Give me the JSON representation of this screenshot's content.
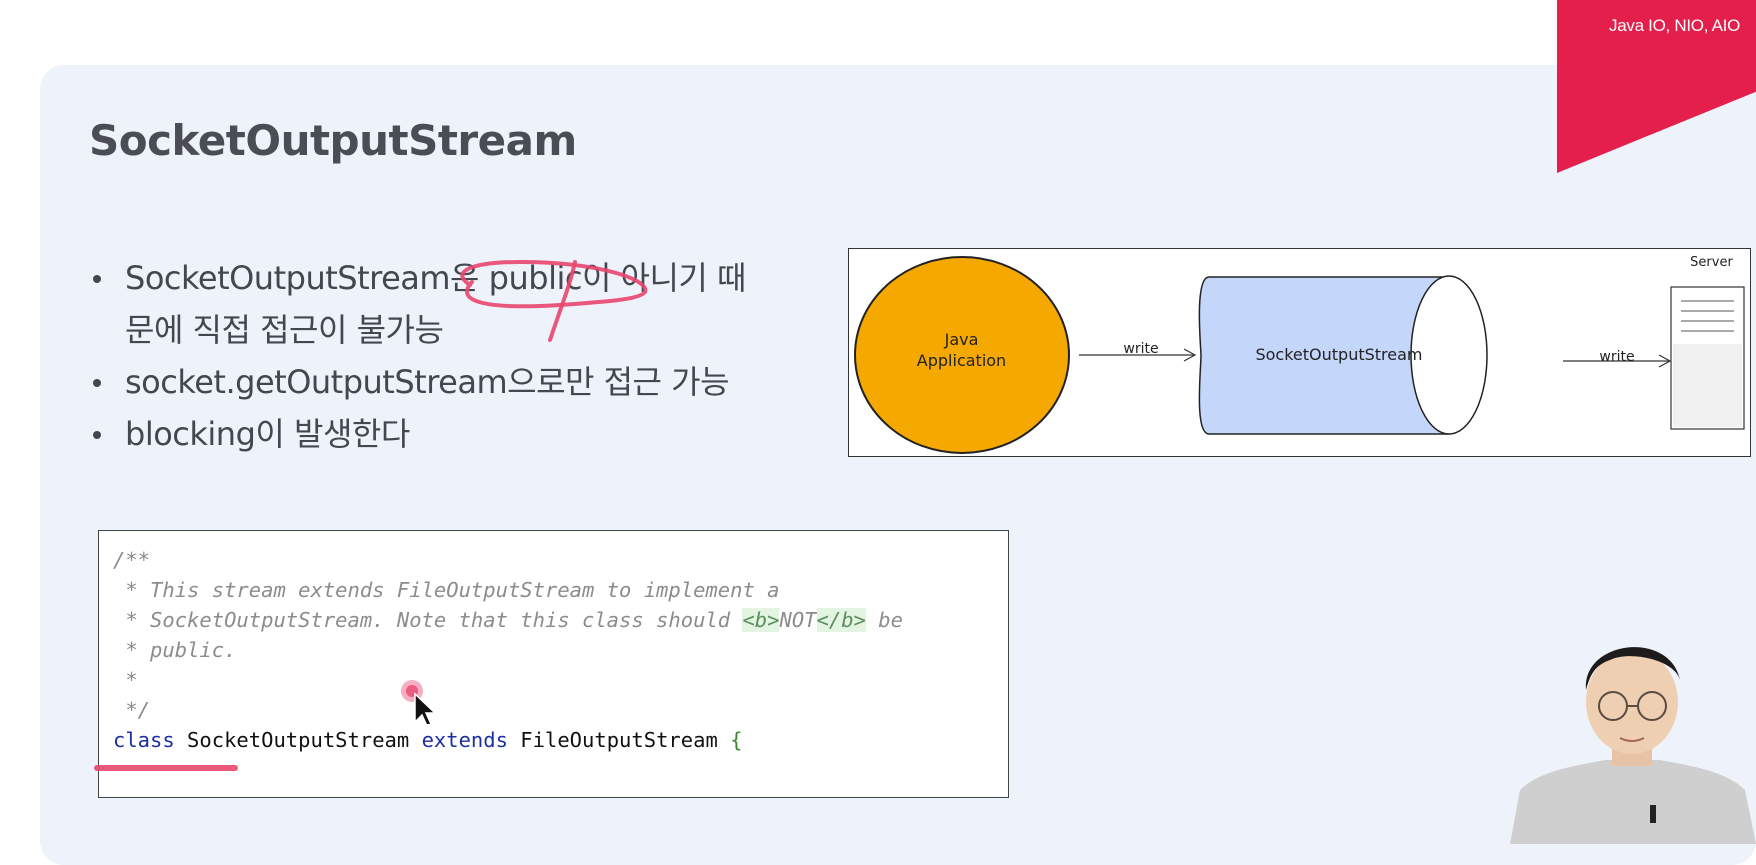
{
  "badge": {
    "label": "Java IO, NIO, AIO"
  },
  "slide": {
    "title": "SocketOutputStream",
    "bullets": [
      {
        "line1": "SocketOutputStream은 public이 아니기 때",
        "line2": "문에 직접 접근이 불가능"
      },
      {
        "line1": "socket.getOutputStream으로만 접근 가능"
      },
      {
        "line1": "blocking이 발생한다"
      }
    ]
  },
  "diagram": {
    "app_label_1": "Java",
    "app_label_2": "Application",
    "arrow1_label": "write",
    "stream_label": "SocketOutputStream",
    "arrow2_label": "write",
    "server_label": "Server",
    "colors": {
      "app": "#f5a800",
      "stream": "#c5d6fb"
    }
  },
  "code": {
    "l1": "/**",
    "l2": " * This stream extends FileOutputStream to implement a",
    "l3a": " * SocketOutputStream. Note that this class should ",
    "l3_tag_open": "<b>",
    "l3_not": "NOT",
    "l3_tag_close": "</b>",
    "l3b": " be",
    "l4": " * public.",
    "l5": " *",
    "l6": " */",
    "kw_class": "class",
    "class_name": " SocketOutputStream ",
    "kw_extends": "extends",
    "parent": " FileOutputStream ",
    "brace": "{"
  },
  "colors": {
    "accent": "#e41f4b",
    "annotation": "#e8476e",
    "slide_bg": "#eef3fb"
  }
}
